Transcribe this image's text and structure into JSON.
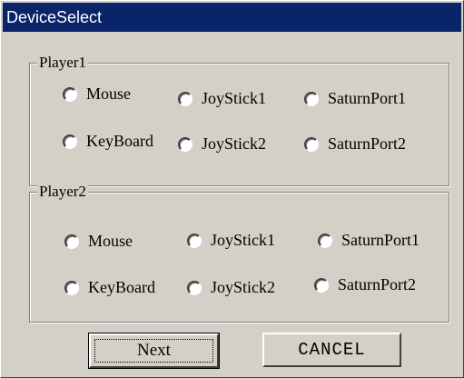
{
  "window": {
    "title": "DeviceSelect"
  },
  "player1": {
    "legend": "Player1",
    "options": [
      "Mouse",
      "JoyStick1",
      "SaturnPort1",
      "KeyBoard",
      "JoyStick2",
      "SaturnPort2"
    ]
  },
  "player2": {
    "legend": "Player2",
    "options": [
      "Mouse",
      "JoyStick1",
      "SaturnPort1",
      "KeyBoard",
      "JoyStick2",
      "SaturnPort2"
    ]
  },
  "buttons": {
    "next": "Next",
    "cancel": "CANCEL"
  }
}
